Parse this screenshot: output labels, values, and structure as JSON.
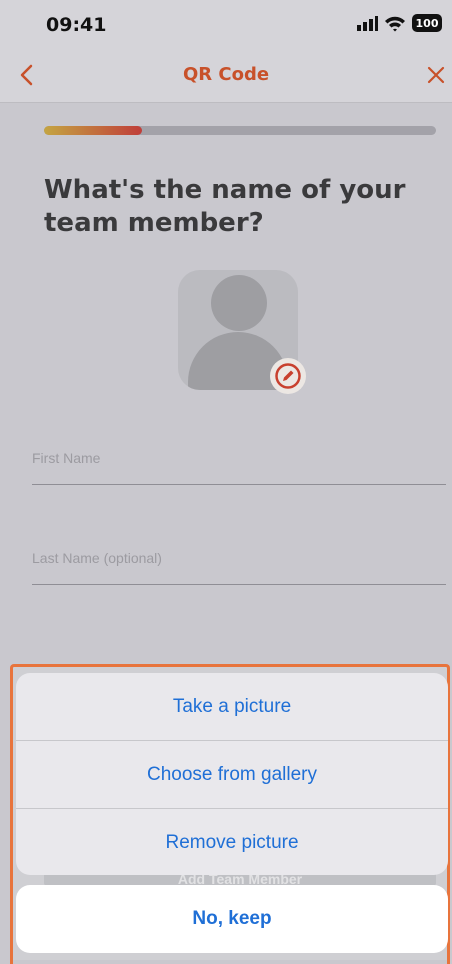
{
  "status_bar": {
    "time": "09:41",
    "battery": "100"
  },
  "nav": {
    "title": "QR Code"
  },
  "progress": {
    "fraction": 0.25
  },
  "question": "What's the name of your team member?",
  "form": {
    "first_name_placeholder": "First Name",
    "last_name_placeholder": "Last Name (optional)"
  },
  "background_button": "Add Team Member",
  "action_sheet": {
    "items": [
      {
        "label": "Take a picture"
      },
      {
        "label": "Choose from gallery"
      },
      {
        "label": "Remove picture"
      }
    ],
    "cancel_label": "No, keep"
  },
  "colors": {
    "accent": "#c8512a",
    "action_blue": "#1f6fd6",
    "sheet_outline": "#e8743c"
  }
}
